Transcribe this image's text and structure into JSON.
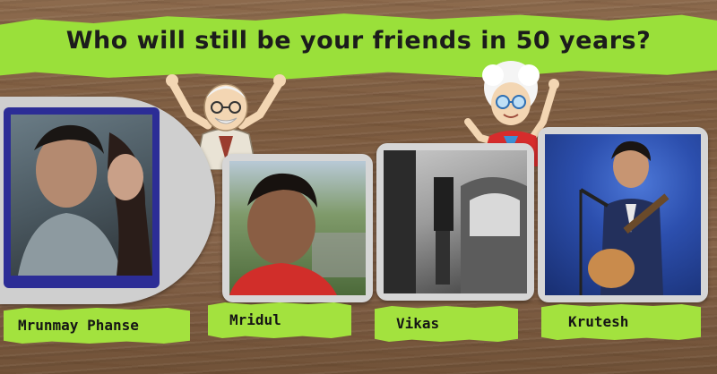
{
  "title": "Who will still be your friends in 50 years?",
  "colors": {
    "banner_green": "#9ae03a",
    "label_green": "#a3e23e",
    "wood": "#7d5c40",
    "card_frame": "#d6d6d6",
    "card_blue_frame": "#2c2d96"
  },
  "friends": [
    {
      "name": "Mrunmay Phanse"
    },
    {
      "name": "Mridul"
    },
    {
      "name": "Vikas"
    },
    {
      "name": "Krutesh"
    }
  ]
}
